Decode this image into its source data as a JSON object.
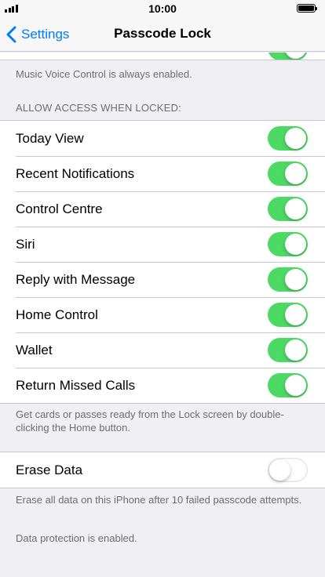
{
  "status_bar": {
    "time": "10:00"
  },
  "nav": {
    "back_label": "Settings",
    "title": "Passcode Lock"
  },
  "music_note": "Music Voice Control is always enabled.",
  "allow_access": {
    "header": "ALLOW ACCESS WHEN LOCKED:",
    "items": [
      {
        "label": "Today View",
        "on": true
      },
      {
        "label": "Recent Notifications",
        "on": true
      },
      {
        "label": "Control Centre",
        "on": true
      },
      {
        "label": "Siri",
        "on": true
      },
      {
        "label": "Reply with Message",
        "on": true
      },
      {
        "label": "Home Control",
        "on": true
      },
      {
        "label": "Wallet",
        "on": true
      },
      {
        "label": "Return Missed Calls",
        "on": true
      }
    ],
    "footer": "Get cards or passes ready from the Lock screen by double-clicking the Home button."
  },
  "erase": {
    "label": "Erase Data",
    "on": false,
    "footer": "Erase all data on this iPhone after 10 failed passcode attempts.",
    "protection_note": "Data protection is enabled."
  },
  "colors": {
    "accent": "#007aff",
    "switch_on": "#4cd964",
    "background": "#efeff4"
  },
  "icons": {
    "back": "chevron-left-icon",
    "signal": "signal-icon",
    "battery": "battery-icon"
  }
}
